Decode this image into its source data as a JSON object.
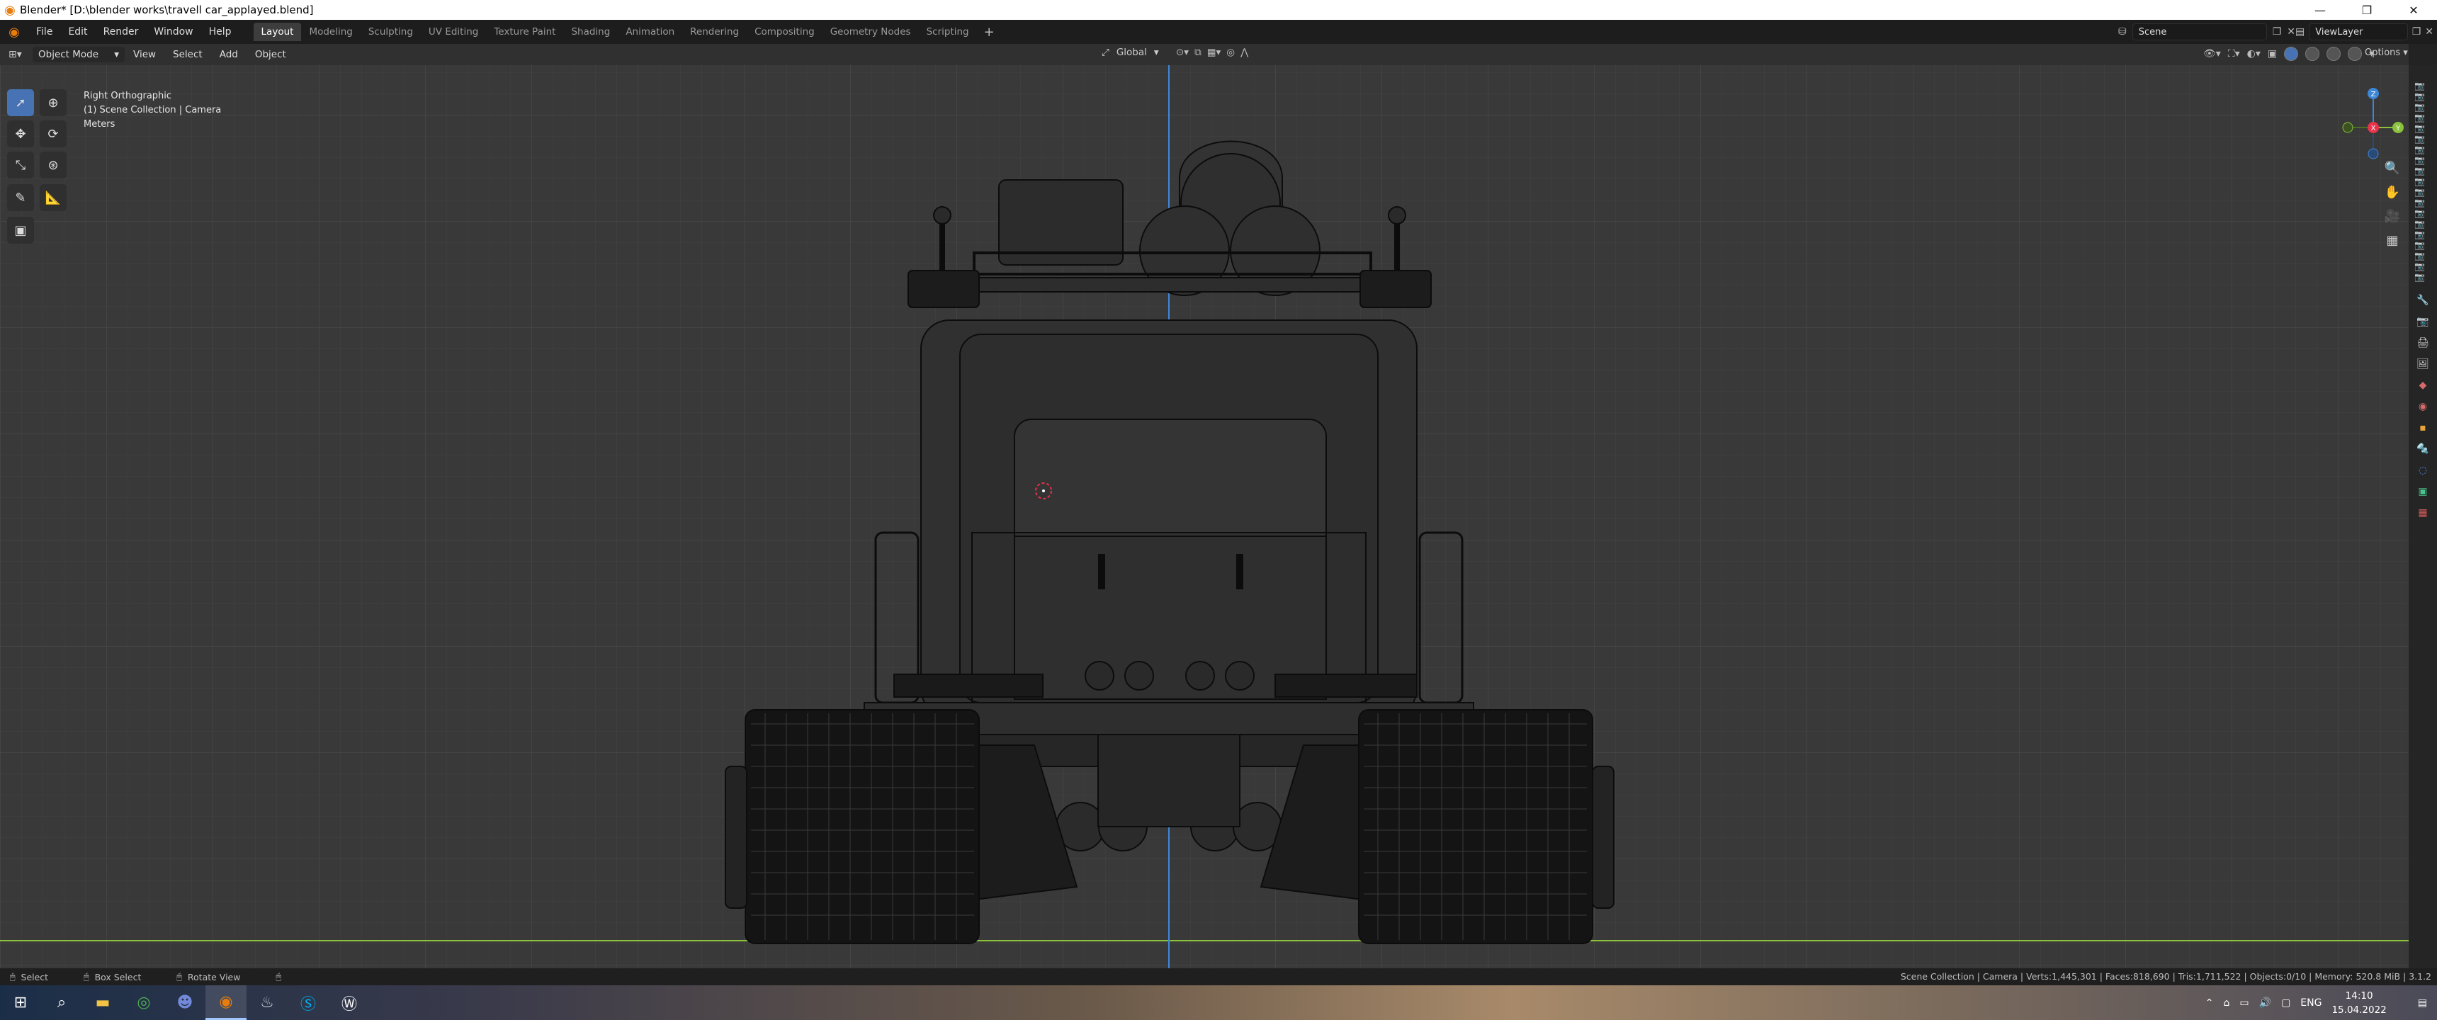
{
  "window": {
    "title": "Blender* [D:\\blender works\\travell car_applayed.blend]",
    "controls": [
      "—",
      "❐",
      "✕"
    ]
  },
  "menu": {
    "items": [
      "File",
      "Edit",
      "Render",
      "Window",
      "Help"
    ]
  },
  "workspaces": {
    "tabs": [
      "Layout",
      "Modeling",
      "Sculpting",
      "UV Editing",
      "Texture Paint",
      "Shading",
      "Animation",
      "Rendering",
      "Compositing",
      "Geometry Nodes",
      "Scripting"
    ],
    "active": "Layout",
    "add_label": "+"
  },
  "scene": {
    "name": "Scene"
  },
  "view_layer": {
    "name": "ViewLayer"
  },
  "viewport_header": {
    "mode": "Object Mode",
    "menus": [
      "View",
      "Select",
      "Add",
      "Object"
    ],
    "transform_orientation": "Global",
    "options_label": "Options"
  },
  "viewport": {
    "view_name": "Right Orthographic",
    "collection": "(1) Scene Collection | Camera",
    "units": "Meters",
    "gizmo_axes": {
      "z": "Z",
      "x": "X",
      "y": "Y"
    }
  },
  "colors": {
    "accent": "#4772b3",
    "blender_orange": "#e87d0d",
    "axis_x": "#e8334a",
    "axis_y": "#8bc23c",
    "axis_z": "#3e87d8",
    "wire": "#000000"
  },
  "statusbar": {
    "hint_select": "Select",
    "hint_box": "Box Select",
    "hint_rotate": "Rotate View",
    "stats": "Scene Collection | Camera | Verts:1,445,301 | Faces:818,690 | Tris:1,711,522 | Objects:0/10 | Memory: 520.8 MiB | 3.1.2"
  },
  "taskbar": {
    "apps": [
      "windows-icon",
      "search-icon",
      "file-explorer-icon",
      "chrome-icon",
      "discord-icon",
      "blender-icon",
      "steam-icon",
      "skype-icon",
      "app-w-icon"
    ],
    "language": "ENG",
    "time": "14:10",
    "date": "15.04.2022"
  }
}
